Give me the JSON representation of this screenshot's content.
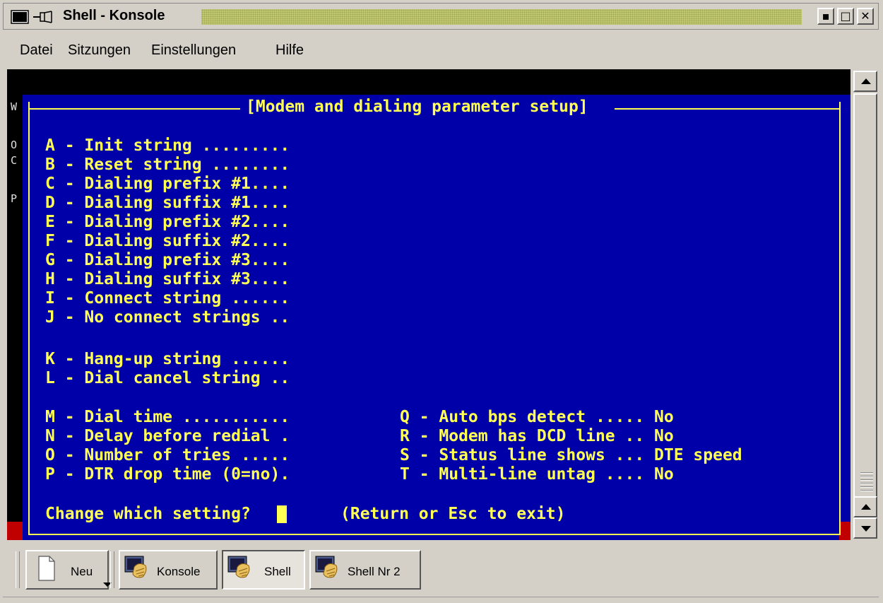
{
  "window": {
    "title": "Shell - Konsole"
  },
  "menu": [
    "Datei",
    "Sitzungen",
    "Einstellungen",
    "Hilfe"
  ],
  "terminal": {
    "side_chars": [
      "W",
      "O",
      "C",
      "P"
    ],
    "dialog_title": "[Modem and dialing parameter setup]",
    "left_options": [
      "A - Init string .........",
      "B - Reset string ........",
      "C - Dialing prefix #1....",
      "D - Dialing suffix #1....",
      "E - Dialing prefix #2....",
      "F - Dialing suffix #2....",
      "G - Dialing prefix #3....",
      "H - Dialing suffix #3....",
      "I - Connect string ......",
      "J - No connect strings ..",
      "K - Hang-up string ......",
      "L - Dial cancel string ..",
      "M - Dial time ...........",
      "N - Delay before redial .",
      "O - Number of tries .....",
      "P - DTR drop time (0=no)."
    ],
    "right_options": [
      "Q - Auto bps detect ..... No",
      "R - Modem has DCD line .. No",
      "S - Status line shows ... DTE speed",
      "T - Multi-line untag .... No"
    ],
    "prompt": "Change which setting?",
    "hint": "(Return or Esc to exit)"
  },
  "taskbar": {
    "new_label": "Neu",
    "buttons": [
      "Konsole",
      "Shell",
      "Shell Nr 2"
    ]
  },
  "colors": {
    "terminal_bg": "#0000a8",
    "terminal_fg": "#ffff54"
  }
}
